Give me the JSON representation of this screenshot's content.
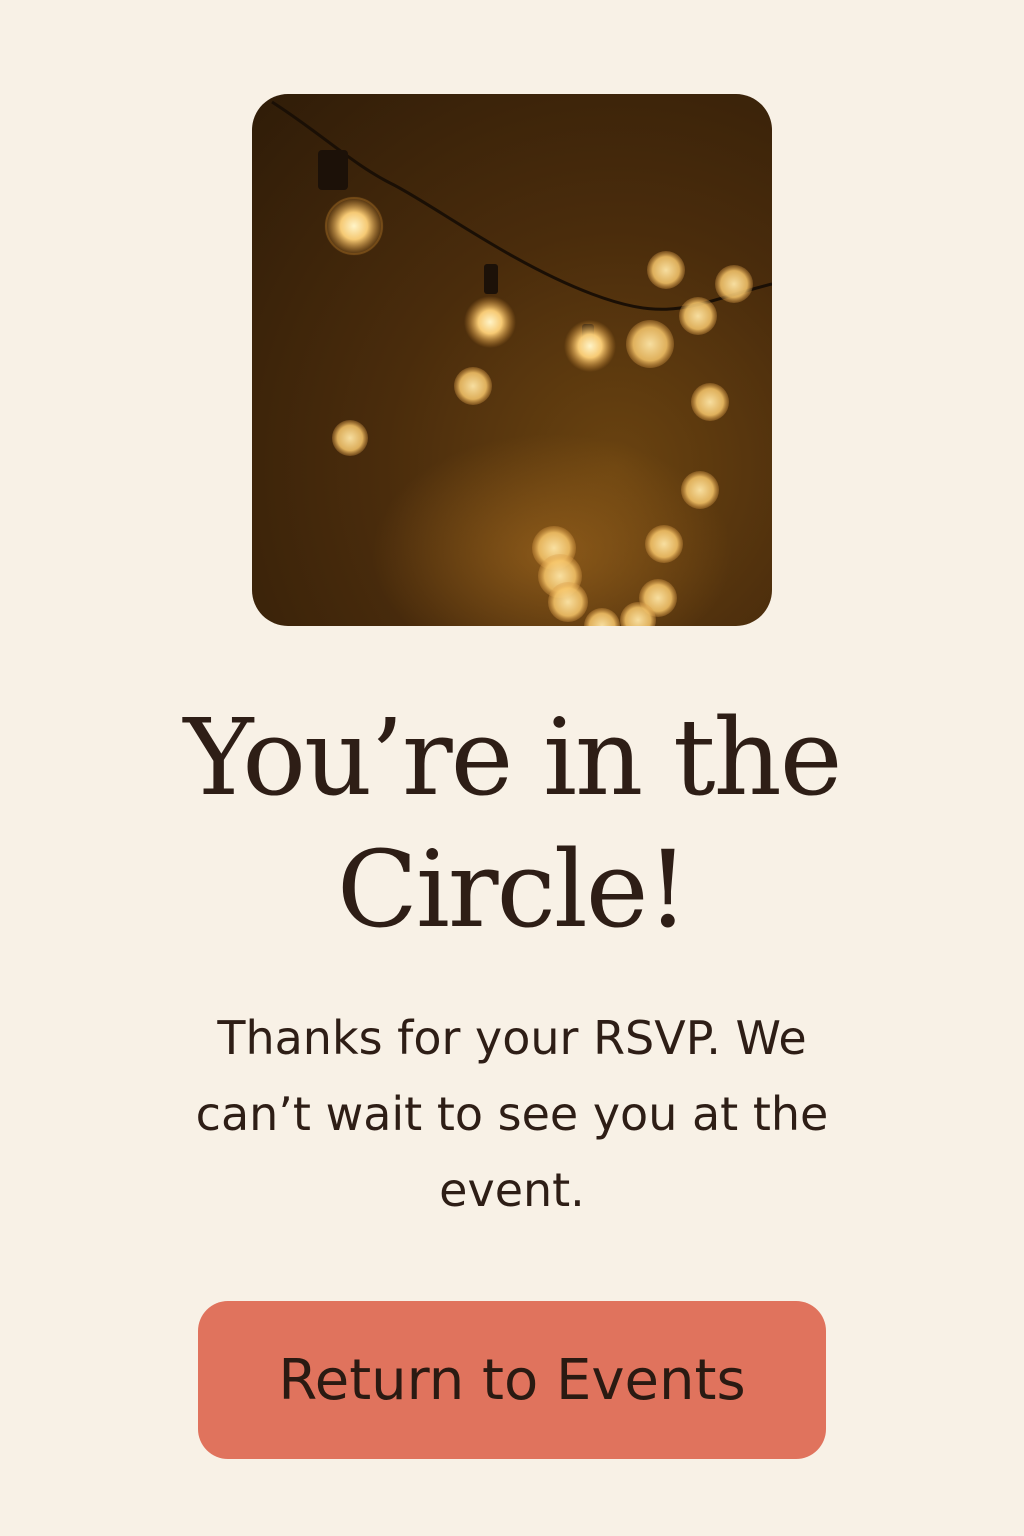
{
  "hero": {
    "image_icon": "string-lights-photo"
  },
  "heading": {
    "title": "You’re in the Circle!"
  },
  "body": {
    "message": "Thanks for your RSVP. We can’t wait to see you at the event."
  },
  "actions": {
    "return_label": "Return to Events"
  },
  "colors": {
    "background": "#f8f1e6",
    "text": "#2e1e16",
    "button": "#e0735d",
    "photo_base": "#3a2409",
    "light_glow": "#ffd27a"
  }
}
